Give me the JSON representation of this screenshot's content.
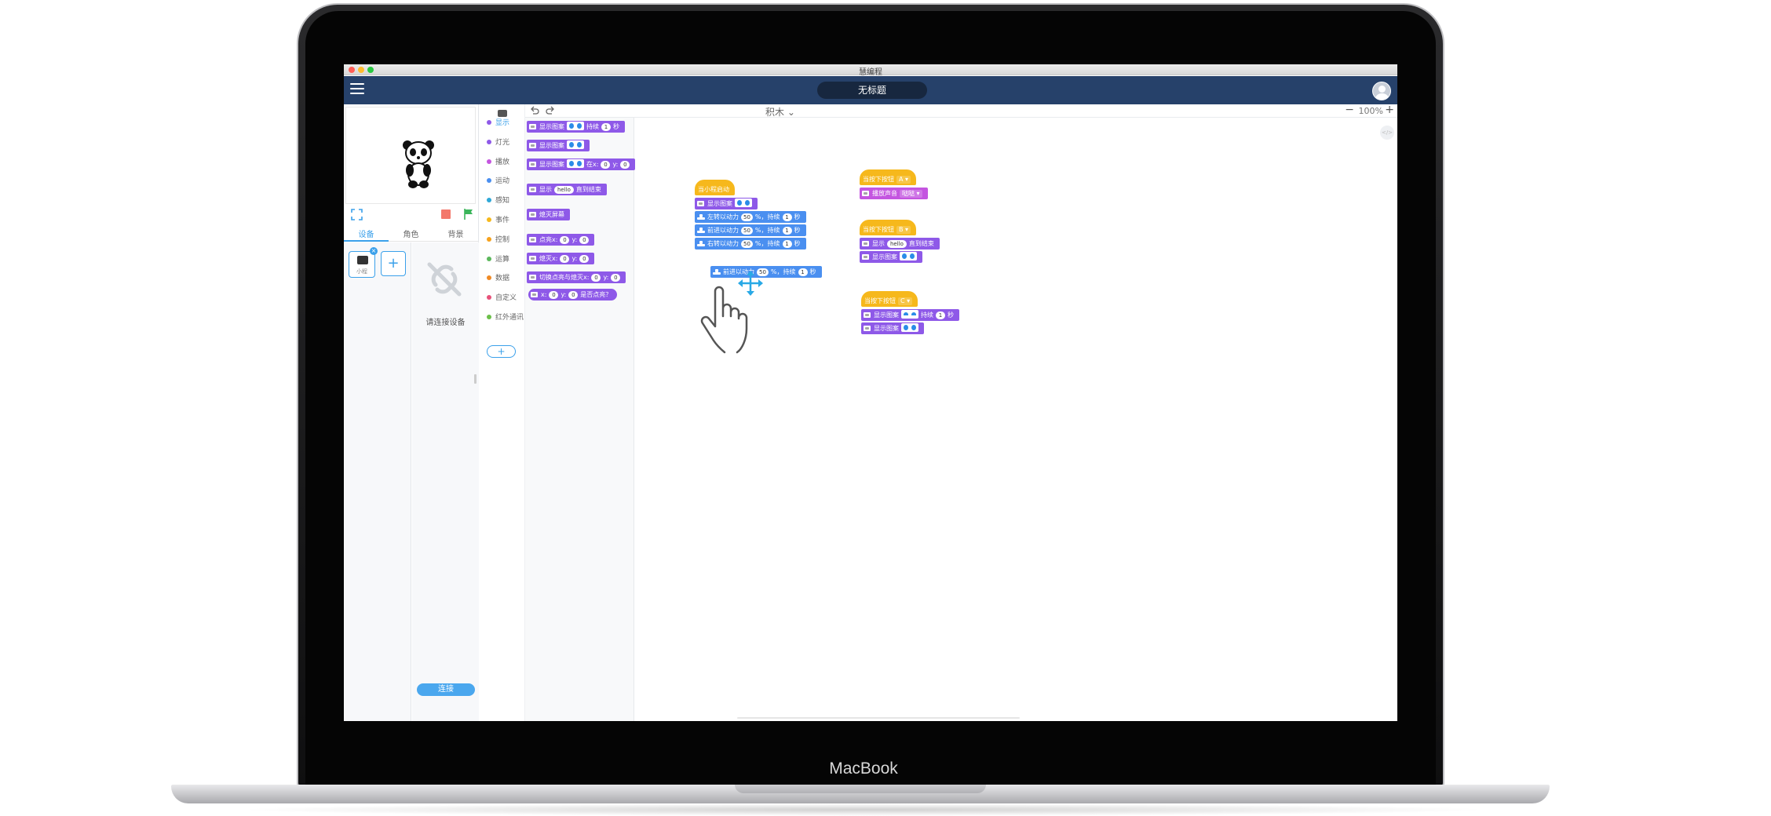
{
  "device_brand": "MacBook",
  "window": {
    "title": "慧编程"
  },
  "header": {
    "project_title": "无标题"
  },
  "left_panel": {
    "tabs": [
      "设备",
      "角色",
      "背景"
    ],
    "device_name": "小程",
    "connect_hint": "请连接设备",
    "connect_button": "连接"
  },
  "categories": [
    {
      "label": "显示",
      "color": "#8e59e8"
    },
    {
      "label": "灯光",
      "color": "#8e59e8"
    },
    {
      "label": "播放",
      "color": "#c455e0"
    },
    {
      "label": "运动",
      "color": "#4a8ff0"
    },
    {
      "label": "感知",
      "color": "#2fa8d8"
    },
    {
      "label": "事件",
      "color": "#f6b81c"
    },
    {
      "label": "控制",
      "color": "#f6a21c"
    },
    {
      "label": "运算",
      "color": "#5cb85c"
    },
    {
      "label": "数据",
      "color": "#f08a24"
    },
    {
      "label": "自定义",
      "color": "#e8527a"
    },
    {
      "label": "红外通讯",
      "color": "#6cc04a"
    }
  ],
  "toolbar": {
    "mode": "积木",
    "zoom": "100%"
  },
  "palette": {
    "show_pattern_for": {
      "text": "显示图案",
      "mid": "持续",
      "num": "1",
      "unit": "秒"
    },
    "show_pattern": {
      "text": "显示图案"
    },
    "show_pattern_at": {
      "text": "显示图案",
      "at": "在x:",
      "x": "0",
      "y_label": "y:",
      "y": "0"
    },
    "show_text": {
      "text": "显示",
      "value": "hello",
      "suffix": "直到结束"
    },
    "clear_screen": {
      "text": "熄灭屏幕"
    },
    "light_on": {
      "text": "点亮x:",
      "x": "0",
      "y_label": "y:",
      "y": "0"
    },
    "light_off": {
      "text": "熄灭x:",
      "x": "0",
      "y_label": "y:",
      "y": "0"
    },
    "toggle": {
      "text": "切换点亮与熄灭x:",
      "x": "0",
      "y_label": "y:",
      "y": "0"
    },
    "is_lit": {
      "x_label": "x:",
      "x": "0",
      "y_label": "y:",
      "y": "0",
      "suffix": "是否点亮？"
    }
  },
  "workspace": {
    "script1": {
      "hat": "当小程启动",
      "show_pattern": "显示图案",
      "turn_left": {
        "text": "左转以动力",
        "power": "50",
        "mid": "%，持续",
        "num": "1",
        "unit": "秒"
      },
      "forward": {
        "text": "前进以动力",
        "power": "50",
        "mid": "%，持续",
        "num": "1",
        "unit": "秒"
      },
      "turn_right": {
        "text": "右转以动力",
        "power": "50",
        "mid": "%，持续",
        "num": "1",
        "unit": "秒"
      }
    },
    "dragged": {
      "text": "前进以动力",
      "power": "50",
      "mid": "%，持续",
      "num": "1",
      "unit": "秒"
    },
    "script2": {
      "hat": "当按下按钮",
      "button": "A",
      "action": "播放声音",
      "sound": "哒哒"
    },
    "script3": {
      "hat": "当按下按钮",
      "button": "B",
      "show": "显示",
      "value": "hello",
      "suffix": "直到结束",
      "pattern": "显示图案"
    },
    "script4": {
      "hat": "当按下按钮",
      "button": "C",
      "pattern_for": "显示图案",
      "mid": "持续",
      "num": "1",
      "unit": "秒",
      "pattern": "显示图案"
    }
  }
}
